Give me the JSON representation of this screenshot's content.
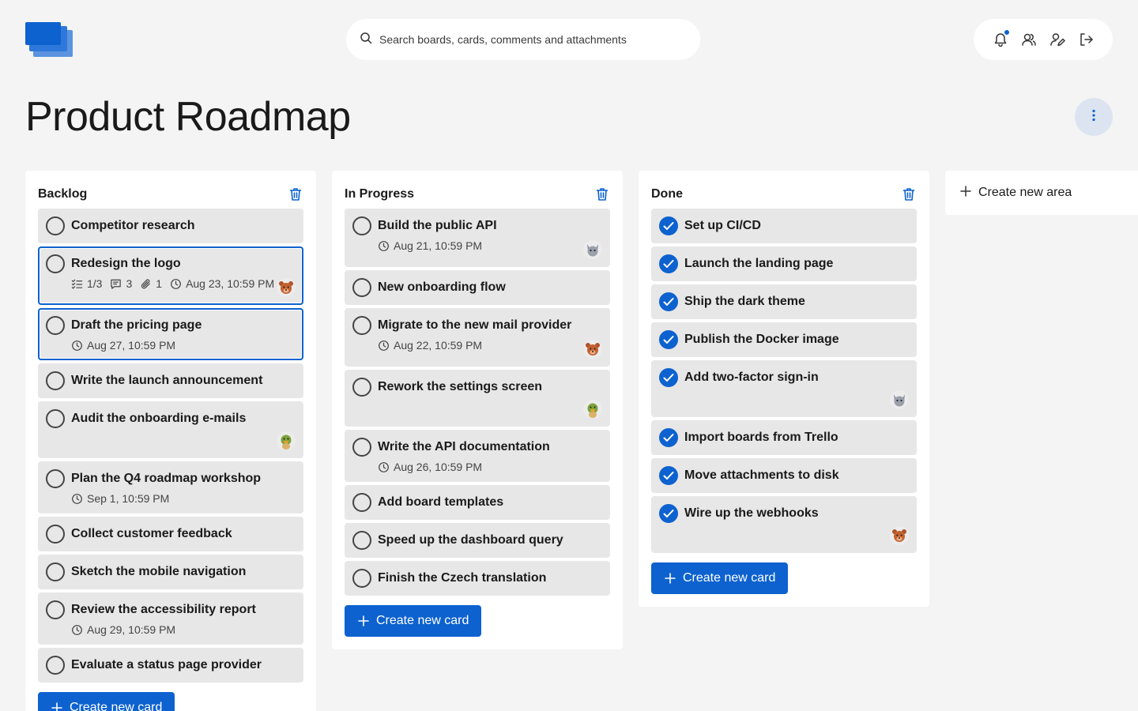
{
  "search": {
    "placeholder": "Search boards, cards, comments and attachments"
  },
  "board": {
    "title": "Product Roadmap"
  },
  "areas": [
    {
      "title": "Backlog",
      "create_label": "Create new card",
      "cards": [
        {
          "title": "Competitor research",
          "done": false
        },
        {
          "title": "Redesign the logo",
          "done": false,
          "selected": true,
          "checklist": "1/3",
          "comments": "3",
          "attachments": "1",
          "date": "Aug 23, 10:59 PM",
          "avatar": "bear"
        },
        {
          "title": "Draft the pricing page",
          "done": false,
          "selected": true,
          "date": "Aug 27, 10:59 PM"
        },
        {
          "title": "Write the launch announcement",
          "done": false
        },
        {
          "title": "Audit the onboarding e-mails",
          "done": false,
          "avatar": "duck"
        },
        {
          "title": "Plan the Q4 roadmap workshop",
          "done": false,
          "date": "Sep 1, 10:59 PM"
        },
        {
          "title": "Collect customer feedback",
          "done": false
        },
        {
          "title": "Sketch the mobile navigation",
          "done": false
        },
        {
          "title": "Review the accessibility report",
          "done": false,
          "date": "Aug 29, 10:59 PM"
        },
        {
          "title": "Evaluate a status page provider",
          "done": false
        }
      ]
    },
    {
      "title": "In Progress",
      "create_label": "Create new card",
      "cards": [
        {
          "title": "Build the public API",
          "done": false,
          "date": "Aug 21, 10:59 PM",
          "avatar": "cat"
        },
        {
          "title": "New onboarding flow",
          "done": false
        },
        {
          "title": "Migrate to the new mail provider",
          "done": false,
          "date": "Aug 22, 10:59 PM",
          "avatar": "bear"
        },
        {
          "title": "Rework the settings screen",
          "done": false,
          "avatar": "duck"
        },
        {
          "title": "Write the API documentation",
          "done": false,
          "date": "Aug 26, 10:59 PM"
        },
        {
          "title": "Add board templates",
          "done": false
        },
        {
          "title": "Speed up the dashboard query",
          "done": false
        },
        {
          "title": "Finish the Czech translation",
          "done": false
        }
      ]
    },
    {
      "title": "Done",
      "create_label": "Create new card",
      "cards": [
        {
          "title": "Set up CI/CD",
          "done": true
        },
        {
          "title": "Launch the landing page",
          "done": true
        },
        {
          "title": "Ship the dark theme",
          "done": true
        },
        {
          "title": "Publish the Docker image",
          "done": true
        },
        {
          "title": "Add two-factor sign-in",
          "done": true,
          "avatar": "cat"
        },
        {
          "title": "Import boards from Trello",
          "done": true
        },
        {
          "title": "Move attachments to disk",
          "done": true
        },
        {
          "title": "Wire up the webhooks",
          "done": true,
          "avatar": "bear"
        }
      ]
    }
  ],
  "new_area_label": "Create new area",
  "colors": {
    "accent": "#0d62cf",
    "card": "#e7e7e7",
    "background": "#f4f4f4"
  },
  "icons": {
    "search": "search-icon",
    "notifications": "bell-icon",
    "users": "users-icon",
    "profile": "user-edit-icon",
    "logout": "logout-icon",
    "menu": "more-vertical-icon",
    "trash": "trash-icon"
  }
}
